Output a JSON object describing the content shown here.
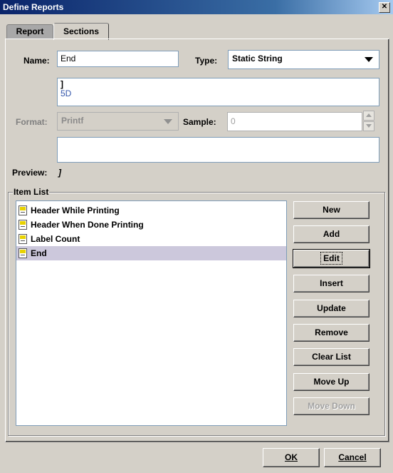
{
  "window": {
    "title": "Define Reports",
    "close_glyph": "✕"
  },
  "tabs": [
    {
      "label": "Report",
      "active": false
    },
    {
      "label": "Sections",
      "active": true
    }
  ],
  "form": {
    "name_label": "Name:",
    "name_value": "End",
    "type_label": "Type:",
    "type_value": "Static String",
    "content_lines": [
      "]",
      "5D"
    ],
    "format_label": "Format:",
    "format_value": "Printf",
    "sample_label": "Sample:",
    "sample_value": "0",
    "preview_label": "Preview:",
    "preview_value": "]"
  },
  "item_list": {
    "legend": "Item List",
    "items": [
      {
        "label": "Header While Printing",
        "selected": false
      },
      {
        "label": "Header When Done Printing",
        "selected": false
      },
      {
        "label": "Label Count",
        "selected": false
      },
      {
        "label": "End",
        "selected": true
      }
    ]
  },
  "buttons": {
    "new": "New",
    "add": "Add",
    "edit": "Edit",
    "insert": "Insert",
    "update": "Update",
    "remove": "Remove",
    "clear_list": "Clear List",
    "move_up": "Move Up",
    "move_down": "Move Down"
  },
  "dialog": {
    "ok": "OK",
    "cancel": "Cancel"
  },
  "colors": {
    "selection": "#ccc8dc",
    "titlebar": "#0a246a"
  }
}
